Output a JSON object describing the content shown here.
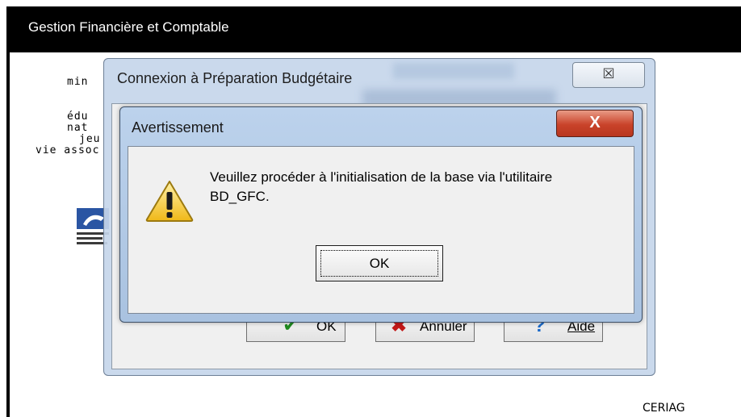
{
  "app": {
    "title": "Gestion Financière et Comptable",
    "ministry_lines": [
      "min",
      "édu",
      "nat",
      "jeu",
      "vie assoc"
    ],
    "footer_label": "CERIAG"
  },
  "connexion_dialog": {
    "title": "Connexion à Préparation Budgétaire",
    "close_glyph": "☒",
    "buttons": {
      "ok_label": "OK",
      "cancel_label": "Annuler",
      "help_label": "Aide"
    }
  },
  "warning_dialog": {
    "title": "Avertissement",
    "close_glyph": "X",
    "message": "Veuillez procéder à l'initialisation de la base via l'utilitaire BD_GFC.",
    "ok_label": "OK",
    "icon": "warning-icon"
  },
  "colors": {
    "titlebar": "#000000",
    "dialog_frame": "#b4cbe7",
    "close_red": "#c9432a",
    "ok_check": "#1f8a1f",
    "cancel_x": "#c21818",
    "help_q": "#1b6ac9"
  }
}
